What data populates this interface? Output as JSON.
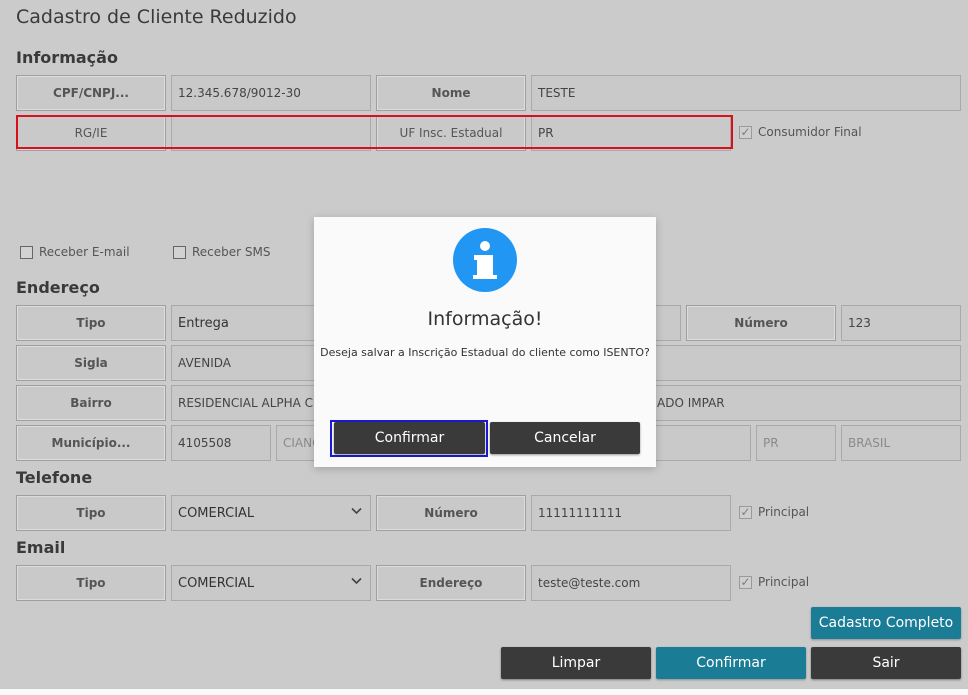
{
  "page": {
    "title": "Cadastro de Cliente Reduzido"
  },
  "info": {
    "heading": "Informação",
    "cpf_label": "CPF/CNPJ...",
    "cpf_value": "12.345.678/9012-30",
    "nome_label": "Nome",
    "nome_value": "TESTE",
    "rg_label": "RG/IE",
    "rg_value": "",
    "uf_label": "UF Insc. Estadual",
    "uf_value": "PR",
    "consumidor_label": "Consumidor Final",
    "consumidor_checked": true,
    "receber_email_label": "Receber E-mail",
    "receber_sms_label": "Receber SMS"
  },
  "endereco": {
    "heading": "Endereço",
    "tipo_label": "Tipo",
    "tipo_value": "Entrega",
    "numero_label": "Número",
    "numero_value": "123",
    "sigla_label": "Sigla",
    "sigla_value": "AVENIDA",
    "bairro_label": "Bairro",
    "bairro_value": "RESIDENCIAL ALPHA CLU",
    "bairro_extra": "ADO IMPAR",
    "municipio_label": "Município...",
    "municipio_code": "4105508",
    "municipio_name": "CIANO",
    "uf": "PR",
    "pais": "BRASIL"
  },
  "telefone": {
    "heading": "Telefone",
    "tipo_label": "Tipo",
    "tipo_value": "COMERCIAL",
    "numero_label": "Número",
    "numero_value": "11111111111",
    "principal_label": "Principal"
  },
  "email": {
    "heading": "Email",
    "tipo_label": "Tipo",
    "tipo_value": "COMERCIAL",
    "endereco_label": "Endereço",
    "endereco_value": "teste@teste.com",
    "principal_label": "Principal"
  },
  "actions": {
    "cadastro_completo": "Cadastro Completo",
    "limpar": "Limpar",
    "confirmar": "Confirmar",
    "sair": "Sair"
  },
  "dialog": {
    "icon": "info-icon",
    "title": "Informação!",
    "message": "Deseja salvar a Inscrição Estadual do cliente como ISENTO?",
    "confirm": "Confirmar",
    "cancel": "Cancelar"
  },
  "colors": {
    "accent": "#1b7c96",
    "dark_button": "#3a3a3a",
    "info_icon": "#2196f3",
    "highlight_border": "#d9101b",
    "focus_border": "#1a1ad6"
  }
}
